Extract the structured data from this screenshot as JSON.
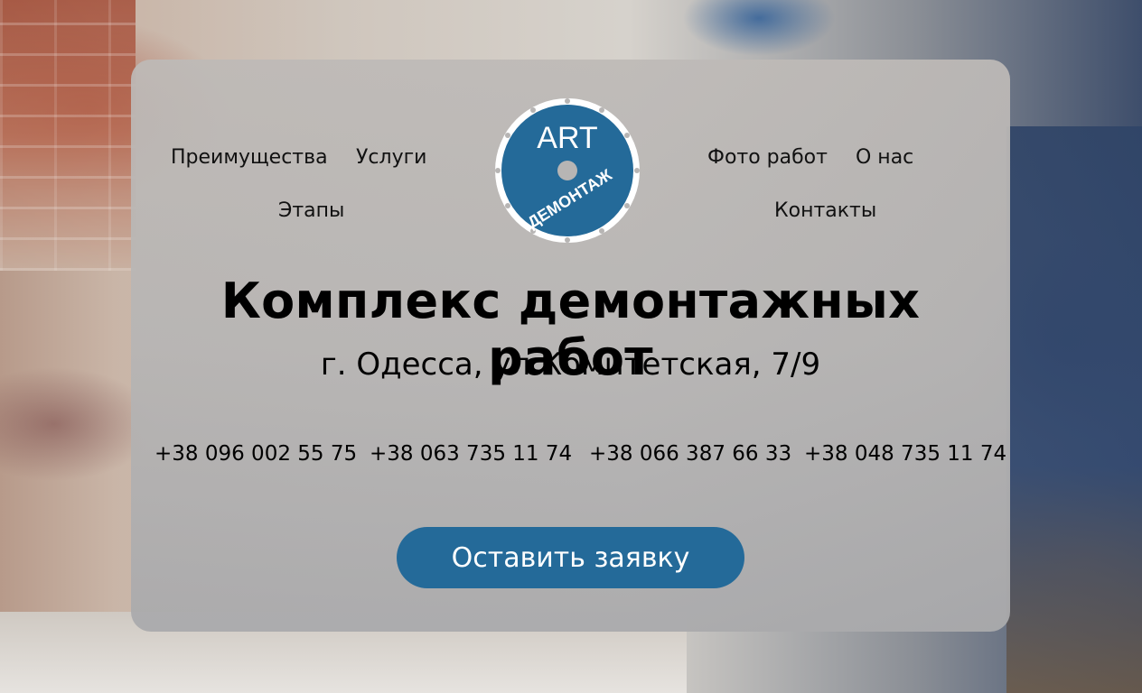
{
  "colors": {
    "accent": "#246a99",
    "card_background": "#b7b5b4",
    "text": "#000000",
    "button_text": "#ffffff"
  },
  "nav": {
    "left": [
      {
        "label": "Преимущества"
      },
      {
        "label": "Услуги"
      },
      {
        "label": "Этапы"
      }
    ],
    "right": [
      {
        "label": "Фото работ"
      },
      {
        "label": "О нас"
      },
      {
        "label": "Контакты"
      }
    ]
  },
  "logo": {
    "icon": "diamond-saw-blade-icon",
    "top_text": "ART",
    "bottom_text": "ДЕМОНТАЖ"
  },
  "hero": {
    "title": "Комплекс демонтажных работ",
    "address": "г. Одесса, ул.Комитетская, 7/9",
    "phones": [
      "+38 096 002 55 75",
      "+38 063 735 11 74",
      "+38 066 387 66 33",
      "+38 048 735 11 74"
    ],
    "cta_label": "Оставить заявку"
  },
  "background": {
    "description_icon": "demolition-worker-photo"
  }
}
